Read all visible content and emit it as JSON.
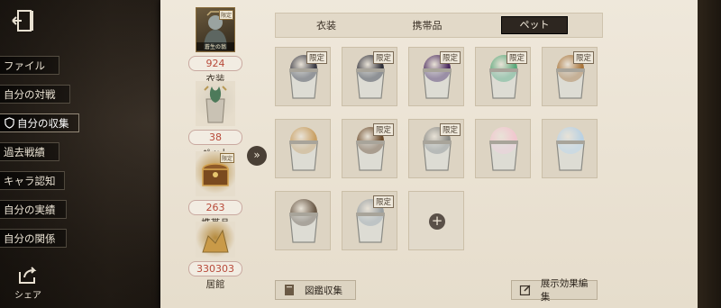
{
  "nav": {
    "items": [
      {
        "label": "ファイル"
      },
      {
        "label": "自分の対戦"
      },
      {
        "label": "自分の収集"
      },
      {
        "label": "過去戦績"
      },
      {
        "label": "キャラ認知"
      },
      {
        "label": "自分の実績"
      },
      {
        "label": "自分の関係"
      }
    ],
    "active_index": 2,
    "share_label": "シェア"
  },
  "summary": {
    "thumb_caption": "蒼生の翁",
    "limited_mini": "限定",
    "blocks": [
      {
        "count": "924",
        "label": "衣装"
      },
      {
        "count": "38",
        "label": "ペット"
      },
      {
        "count": "263",
        "label": "携帯品"
      },
      {
        "count": "330303",
        "label": "居館"
      }
    ]
  },
  "expand_icon": "»",
  "tabs": [
    {
      "label": "衣装"
    },
    {
      "label": "携帯品"
    },
    {
      "label": "ペット",
      "selected": true
    }
  ],
  "grid": {
    "limited_badge": "限定",
    "items": [
      {
        "limited": true,
        "color": "#3b3b44"
      },
      {
        "limited": true,
        "color": "#2f2f38"
      },
      {
        "limited": true,
        "color": "#4a2a5e"
      },
      {
        "limited": true,
        "color": "#5aa87a"
      },
      {
        "limited": true,
        "color": "#a8743a"
      },
      {
        "limited": false,
        "color": "#c9a064"
      },
      {
        "limited": true,
        "color": "#6b4a2a"
      },
      {
        "limited": true,
        "color": "#8b8b86"
      },
      {
        "limited": false,
        "color": "#f1c7cf"
      },
      {
        "limited": false,
        "color": "#b9d1e3"
      },
      {
        "limited": false,
        "color": "#6b5a48"
      },
      {
        "limited": true,
        "color": "#9aa0a2"
      }
    ],
    "add_symbol": "+"
  },
  "buttons": {
    "collection": "図鑑収集",
    "display_edit": "展示効果編集"
  },
  "colors": {
    "panel_bg": "#ece4d6",
    "count_text": "#b84a3a",
    "tab_selected_bg": "#2d2620"
  }
}
